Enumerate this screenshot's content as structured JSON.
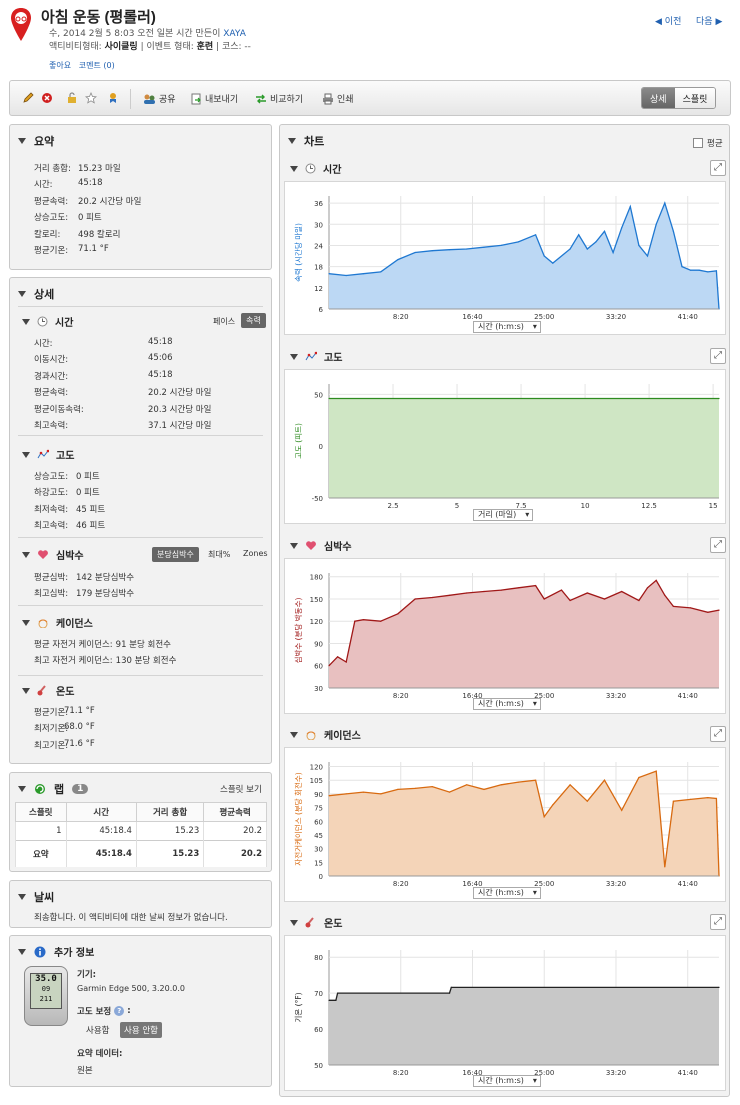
{
  "header": {
    "title": "아침 운동 (평롤러)",
    "line1": "수, 2014 2월 5 8:03 오전 일본 시간 만든이 ",
    "author": "XAYA",
    "line2_a": "액티비티형태: ",
    "activity_type": "사이클링",
    "line2_b": " | 이벤트 형태: ",
    "event_type": "훈련",
    "line2_c": " | 코스: --",
    "like": "좋아요",
    "comment": "코멘트 (0)",
    "prev": "이전",
    "next": "다음"
  },
  "toolbar": {
    "share": "공유",
    "export": "내보내기",
    "compare": "비교하기",
    "print": "인쇄",
    "detail": "상세",
    "split": "스플릿"
  },
  "summary": {
    "title": "요약",
    "rows": [
      {
        "k": "거리 총합:",
        "v": "15.23 마일"
      },
      {
        "k": "시간:",
        "v": "45:18"
      },
      {
        "k": "평균속력:",
        "v": "20.2 시간당 마일"
      },
      {
        "k": "상승고도:",
        "v": "0 피트"
      },
      {
        "k": "칼로리:",
        "v": "498 칼로리"
      },
      {
        "k": "평균기온:",
        "v": "71.1 °F"
      }
    ]
  },
  "details": {
    "title": "상세",
    "time": {
      "title": "시간",
      "pace": "페이스",
      "speed": "속력",
      "rows": [
        {
          "k": "시간:",
          "v": "45:18"
        },
        {
          "k": "이동시간:",
          "v": "45:06"
        },
        {
          "k": "경과시간:",
          "v": "45:18"
        },
        {
          "k": "평균속력:",
          "v": "20.2 시간당 마일"
        },
        {
          "k": "평균이동속력:",
          "v": "20.3 시간당 마일"
        },
        {
          "k": "최고속력:",
          "v": "37.1 시간당 마일"
        }
      ]
    },
    "elevation": {
      "title": "고도",
      "rows": [
        {
          "k": "상승고도:",
          "v": "0 피트"
        },
        {
          "k": "하강고도:",
          "v": "0 피트"
        },
        {
          "k": "최저속력:",
          "v": "45 피트"
        },
        {
          "k": "최고속력:",
          "v": "46 피트"
        }
      ]
    },
    "hr": {
      "title": "심박수",
      "bpm": "분당심박수",
      "max": "최대%",
      "zones": "Zones",
      "rows": [
        {
          "k": "평균심박:",
          "v": "142 분당심박수"
        },
        {
          "k": "최고심박:",
          "v": "179 분당심박수"
        }
      ]
    },
    "cadence": {
      "title": "케이던스",
      "rows": [
        {
          "k": "평균 자전거 케이던스:",
          "v": "91 분당 회전수"
        },
        {
          "k": "최고 자전거 케이던스:",
          "v": "130 분당 회전수"
        }
      ]
    },
    "temp": {
      "title": "온도",
      "rows": [
        {
          "k": "평균기온:",
          "v": "71.1 °F"
        },
        {
          "k": "최저기온:",
          "v": "68.0 °F"
        },
        {
          "k": "최고기온:",
          "v": "71.6 °F"
        }
      ]
    }
  },
  "laps": {
    "title": "랩",
    "count": "1",
    "split_view": "스플릿 보기",
    "headers": [
      "스플릿",
      "시간",
      "거리 총합",
      "평균속력"
    ],
    "row": [
      "1",
      "45:18.4",
      "15.23",
      "20.2"
    ],
    "total": [
      "요약",
      "45:18.4",
      "15.23",
      "20.2"
    ]
  },
  "weather": {
    "title": "날씨",
    "text": "죄송합니다. 이 액티비티에 대한 날씨 정보가 없습니다."
  },
  "info": {
    "title": "추가 정보",
    "device_label": "기기:",
    "device": "Garmin Edge 500, 3.20.0.0",
    "elev_corr": "고도 보정",
    "use": "사용함",
    "nouse": "사용 안함",
    "summary_data": "요약 데이터:",
    "source": "원본",
    "gps_screen": [
      "35.0",
      "09",
      "211"
    ]
  },
  "charts": {
    "title": "차트",
    "avg": "평균",
    "speed": {
      "title": "시간",
      "select": "시간 (h:m:s)"
    },
    "elev": {
      "title": "고도",
      "select": "거리 (마일)"
    },
    "hr": {
      "title": "심박수",
      "select": "시간 (h:m:s)"
    },
    "cad": {
      "title": "케이던스",
      "select": "시간 (h:m:s)"
    },
    "temp": {
      "title": "온도",
      "select": "시간 (h:m:s)"
    }
  },
  "chart_data": [
    {
      "type": "area",
      "ylabel": "속력 (시간당 마일)",
      "xlabel": "시간 (h:m:s)",
      "xticks": [
        "8:20",
        "16:40",
        "25:00",
        "33:20",
        "41:40"
      ],
      "yticks": [
        6,
        12,
        18,
        24,
        30,
        36
      ],
      "ylim": [
        6,
        38
      ],
      "x_min": [
        0,
        2,
        4,
        6,
        8,
        10,
        12,
        14,
        16,
        18,
        20,
        22,
        24,
        25,
        26,
        28,
        29,
        30,
        31,
        32,
        33,
        34,
        35,
        36,
        37,
        38,
        39,
        40,
        41,
        42,
        43,
        44,
        45,
        45.3
      ],
      "values": [
        16,
        15.5,
        16,
        16.5,
        20,
        22,
        22.5,
        22.8,
        23,
        23.5,
        24,
        25,
        27,
        21,
        19,
        23,
        27,
        23,
        25,
        28,
        22,
        29,
        35,
        24,
        21,
        30,
        36,
        28,
        18,
        17,
        17,
        16.5,
        16.8,
        6
      ],
      "color": "#1f78d1"
    },
    {
      "type": "area",
      "ylabel": "고도 (피트)",
      "xlabel": "거리 (마일)",
      "xticks": [
        "2.5",
        "5",
        "7.5",
        "10",
        "12.5",
        "15"
      ],
      "yticks": [
        -50,
        0,
        50
      ],
      "ylim": [
        -50,
        60
      ],
      "value": 46,
      "color": "#2e8b20"
    },
    {
      "type": "area",
      "ylabel": "심박수 (분당 박동수)",
      "xlabel": "시간 (h:m:s)",
      "xticks": [
        "8:20",
        "16:40",
        "25:00",
        "33:20",
        "41:40"
      ],
      "yticks": [
        30,
        60,
        90,
        120,
        150,
        180
      ],
      "ylim": [
        30,
        185
      ],
      "x_min": [
        0,
        1,
        2,
        3,
        4,
        6,
        8,
        10,
        12,
        14,
        16,
        18,
        20,
        22,
        24,
        25,
        27,
        28,
        30,
        32,
        34,
        36,
        37,
        38,
        39,
        40,
        42,
        44,
        45.3
      ],
      "values": [
        60,
        72,
        65,
        120,
        122,
        120,
        130,
        150,
        152,
        155,
        158,
        160,
        162,
        165,
        168,
        150,
        162,
        148,
        158,
        150,
        160,
        148,
        165,
        175,
        155,
        140,
        138,
        132,
        135
      ],
      "color": "#a01818"
    },
    {
      "type": "area",
      "ylabel": "자전거케이던스 (분당 회전수)",
      "xlabel": "시간 (h:m:s)",
      "xticks": [
        "8:20",
        "16:40",
        "25:00",
        "33:20",
        "41:40"
      ],
      "yticks": [
        0,
        15,
        30,
        45,
        60,
        75,
        90,
        105,
        120
      ],
      "ylim": [
        0,
        125
      ],
      "x_min": [
        0,
        2,
        4,
        6,
        8,
        10,
        12,
        14,
        16,
        18,
        20,
        22,
        24,
        25,
        26,
        28,
        30,
        32,
        34,
        36,
        38,
        39,
        40,
        42,
        44,
        45,
        45.3
      ],
      "values": [
        88,
        90,
        92,
        90,
        95,
        96,
        98,
        92,
        100,
        95,
        100,
        103,
        105,
        65,
        78,
        100,
        82,
        105,
        72,
        108,
        115,
        10,
        82,
        84,
        86,
        85,
        0
      ],
      "color": "#d86a10"
    },
    {
      "type": "area",
      "ylabel": "기온 (°F)",
      "xlabel": "시간 (h:m:s)",
      "xticks": [
        "8:20",
        "16:40",
        "25:00",
        "33:20",
        "41:40"
      ],
      "yticks": [
        50,
        60,
        70,
        80
      ],
      "ylim": [
        50,
        82
      ],
      "x_min": [
        0,
        0.8,
        1,
        14,
        14.2,
        45.3
      ],
      "values": [
        68,
        68,
        70,
        70,
        71.6,
        71.6
      ],
      "color": "#222222"
    }
  ]
}
